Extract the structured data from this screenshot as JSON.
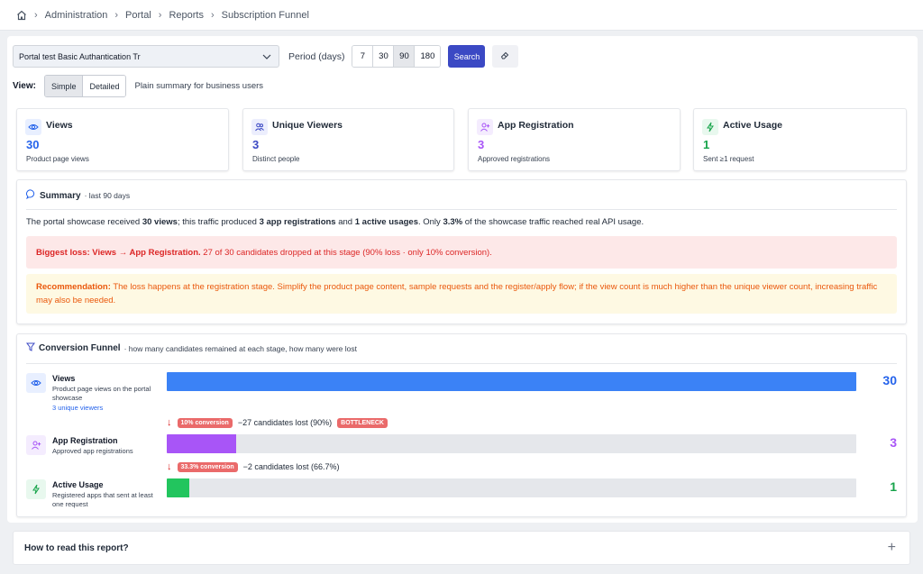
{
  "breadcrumb": [
    "Administration",
    "Portal",
    "Reports",
    "Subscription Funnel"
  ],
  "filters": {
    "portal_select": "Portal test Basic Authantication Tr",
    "period_label": "Period (days)",
    "periods": [
      "7",
      "30",
      "90",
      "180"
    ],
    "selected_period": "90",
    "search_label": "Search"
  },
  "view": {
    "label": "View:",
    "options": [
      "Simple",
      "Detailed"
    ],
    "selected": "Simple",
    "description": "Plain summary for business users"
  },
  "cards": [
    {
      "title": "Views",
      "value": "30",
      "sub": "Product page views",
      "color": "#2563eb",
      "icon": "eye-icon"
    },
    {
      "title": "Unique Viewers",
      "value": "3",
      "sub": "Distinct people",
      "color": "#3b49c4",
      "icon": "users-icon"
    },
    {
      "title": "App Registration",
      "value": "3",
      "sub": "Approved registrations",
      "color": "#a855f7",
      "icon": "user-plus-icon"
    },
    {
      "title": "Active Usage",
      "value": "1",
      "sub": "Sent ≥1 request",
      "color": "#16a34a",
      "icon": "bolt-icon"
    }
  ],
  "summary": {
    "title": "Summary",
    "meta": "· last 90 days",
    "t1": "The portal showcase received ",
    "b1": "30 views",
    "t2": "; this traffic produced ",
    "b2": "3 app registrations",
    "t3": " and ",
    "b3": "1 active usages",
    "t4": ". Only ",
    "b4": "3.3%",
    "t5": " of the showcase traffic reached real API usage.",
    "loss_bold": "Biggest loss: Views → App Registration.",
    "loss_text": " 27 of 30 candidates dropped at this stage (90% loss · only 10% conversion).",
    "rec_bold": "Recommendation:",
    "rec_text": " The loss happens at the registration stage. Simplify the product page content, sample requests and the register/apply flow; if the view count is much higher than the unique viewer count, increasing traffic may also be needed."
  },
  "funnel": {
    "title": "Conversion Funnel",
    "meta": "· how many candidates remained at each stage, how many were lost",
    "stages": [
      {
        "name": "Views",
        "desc": "Product page views on the portal showcase",
        "link": "3 unique viewers",
        "count": "30",
        "fraction": 1.0,
        "color": "#3b82f6",
        "icon": "eye-icon"
      },
      {
        "name": "App Registration",
        "desc": "Approved app registrations",
        "count": "3",
        "fraction": 0.1,
        "color": "#a855f7",
        "icon": "user-plus-icon"
      },
      {
        "name": "Active Usage",
        "desc": "Registered apps that sent at least one request",
        "count": "1",
        "fraction": 0.0333,
        "color": "#22c55e",
        "icon": "bolt-icon"
      }
    ],
    "drops": [
      {
        "conversion": "10% conversion",
        "lost": "−27 candidates lost (90%)",
        "badge": "BOTTLENECK"
      },
      {
        "conversion": "33.3% conversion",
        "lost": "−2 candidates lost (66.7%)"
      }
    ]
  },
  "howto": {
    "label": "How to read this report?"
  }
}
